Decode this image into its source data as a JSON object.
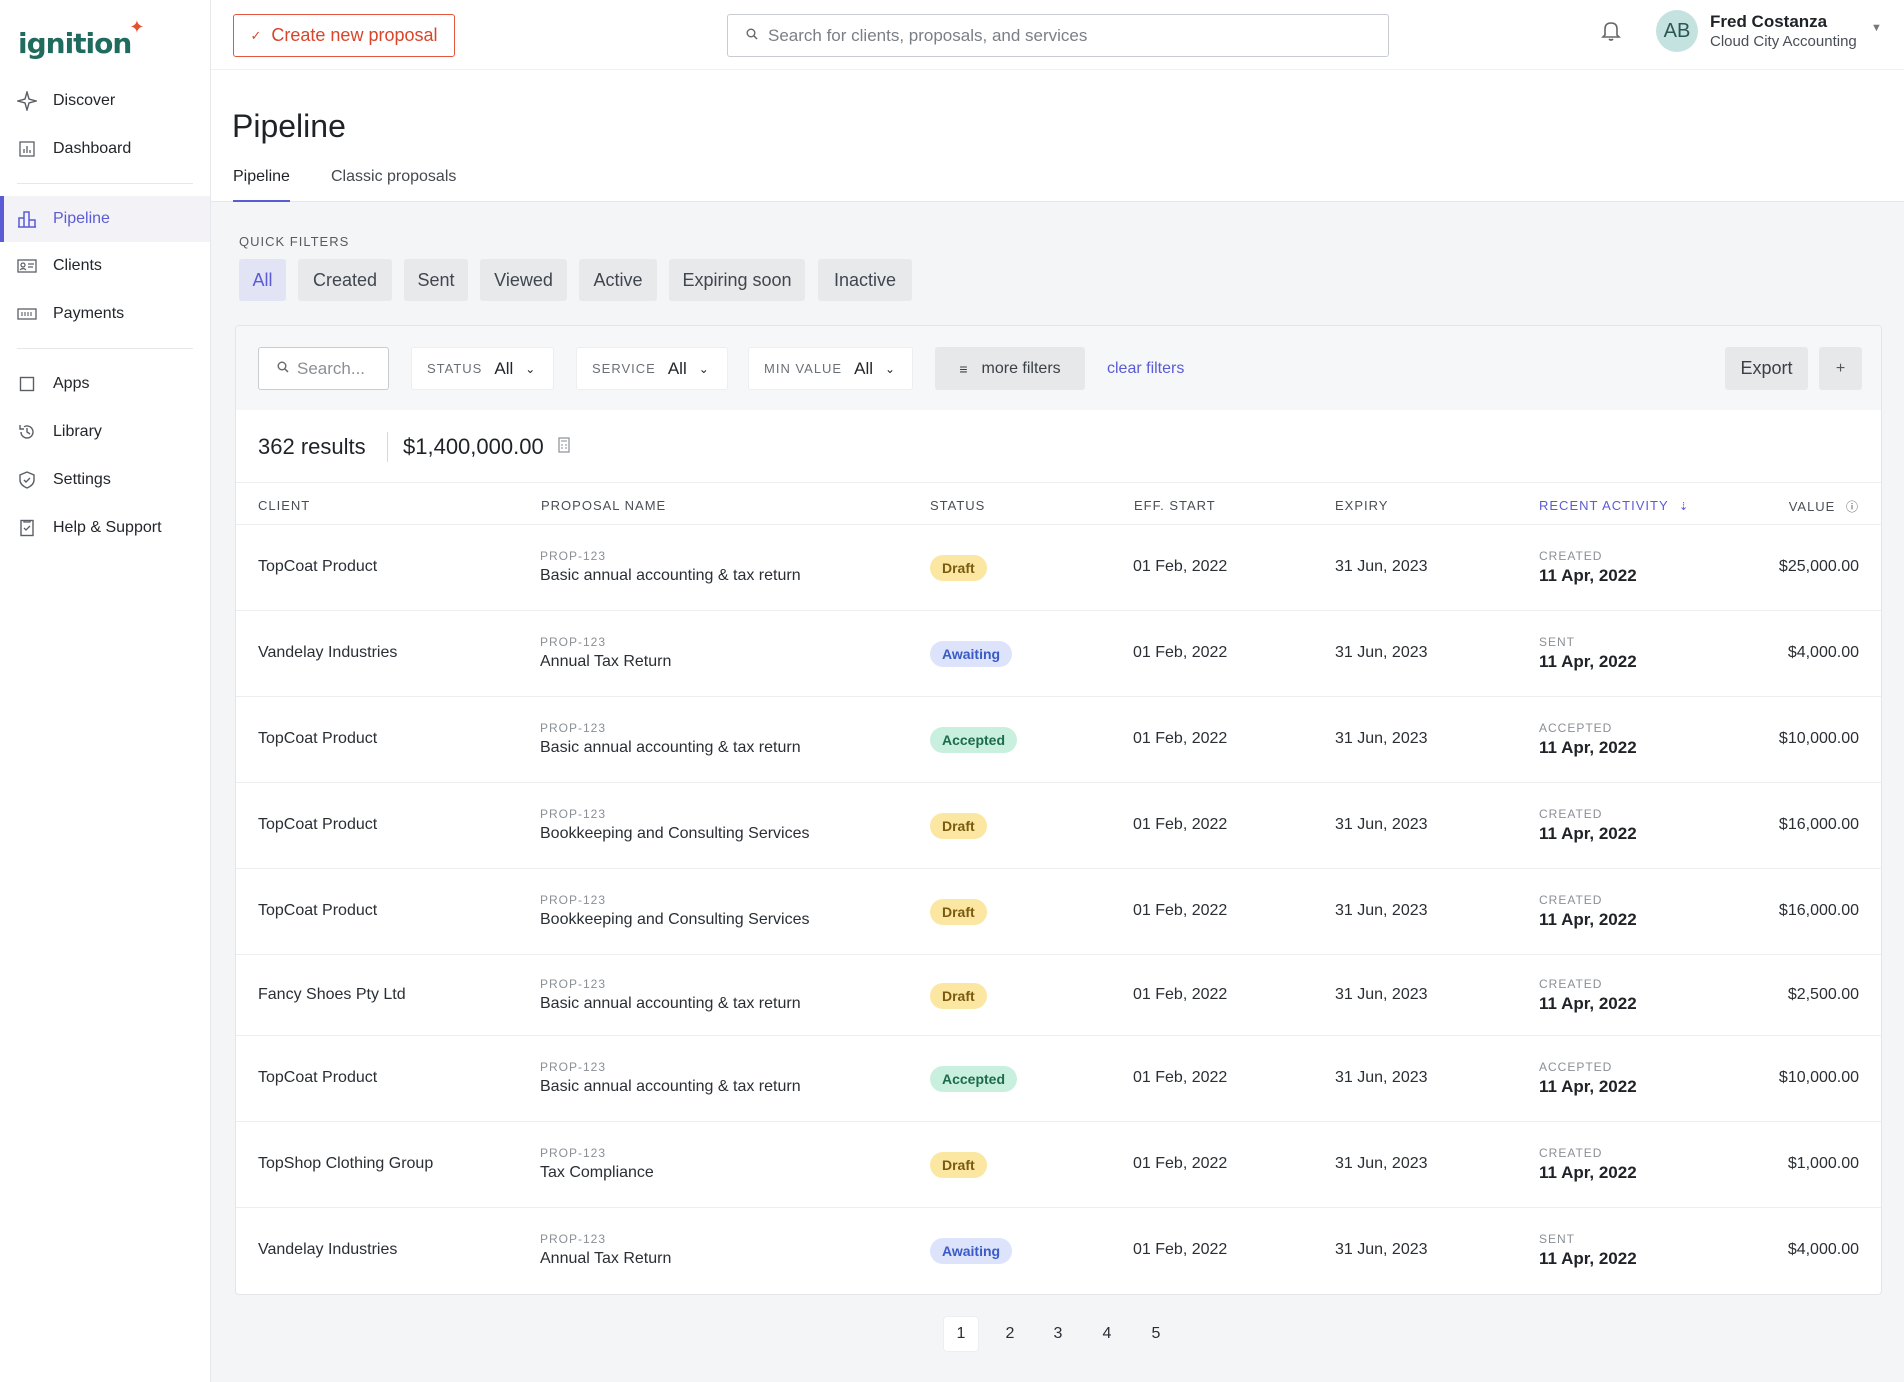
{
  "brand": {
    "name": "ignition",
    "accent": "#5b5bd6",
    "cta_color": "#d9452b"
  },
  "sidebar": {
    "items": [
      {
        "label": "Discover",
        "icon": "sparkle-icon"
      },
      {
        "label": "Dashboard",
        "icon": "dashboard-icon"
      },
      {
        "label": "Pipeline",
        "icon": "bar-chart-icon",
        "active": true
      },
      {
        "label": "Clients",
        "icon": "id-card-icon"
      },
      {
        "label": "Payments",
        "icon": "money-icon"
      },
      {
        "label": "Apps",
        "icon": "square-icon"
      },
      {
        "label": "Library",
        "icon": "library-icon"
      },
      {
        "label": "Settings",
        "icon": "shield-icon"
      },
      {
        "label": "Help & Support",
        "icon": "help-doc-icon"
      }
    ]
  },
  "header": {
    "create_label": "Create new proposal",
    "search_placeholder": "Search for clients, proposals, and services",
    "user": {
      "initials": "AB",
      "name": "Fred Costanza",
      "org": "Cloud City Accounting"
    }
  },
  "page": {
    "title": "Pipeline",
    "tabs": [
      {
        "label": "Pipeline",
        "active": true
      },
      {
        "label": "Classic proposals"
      }
    ]
  },
  "quick_filters": {
    "label": "QUICK FILTERS",
    "chips": [
      "All",
      "Created",
      "Sent",
      "Viewed",
      "Active",
      "Expiring soon",
      "Inactive"
    ],
    "selected": "All"
  },
  "filters": {
    "search_placeholder": "Search...",
    "status": {
      "label": "STATUS",
      "value": "All"
    },
    "service": {
      "label": "SERVICE",
      "value": "All"
    },
    "min_value": {
      "label": "MIN VALUE",
      "value": "All"
    },
    "more_label": "more filters",
    "clear_label": "clear filters",
    "export_label": "Export",
    "add_label": "+"
  },
  "summary": {
    "results": "362 results",
    "total": "$1,400,000.00"
  },
  "table": {
    "columns": [
      "CLIENT",
      "PROPOSAL NAME",
      "STATUS",
      "EFF. START",
      "EXPIRY",
      "RECENT ACTIVITY",
      "VALUE"
    ],
    "rows": [
      {
        "client": "TopCoat Product",
        "prop_id": "PROP-123",
        "proposal": "Basic annual accounting & tax return",
        "status": "Draft",
        "start": "01 Feb, 2022",
        "expiry": "31 Jun, 2023",
        "act_label": "CREATED",
        "act_date": "11 Apr, 2022",
        "value": "$25,000.00"
      },
      {
        "client": "Vandelay Industries",
        "prop_id": "PROP-123",
        "proposal": "Annual Tax Return",
        "status": "Awaiting",
        "start": "01 Feb, 2022",
        "expiry": "31 Jun, 2023",
        "act_label": "SENT",
        "act_date": "11 Apr, 2022",
        "value": "$4,000.00"
      },
      {
        "client": "TopCoat Product",
        "prop_id": "PROP-123",
        "proposal": "Basic annual accounting & tax return",
        "status": "Accepted",
        "start": "01 Feb, 2022",
        "expiry": "31 Jun, 2023",
        "act_label": "ACCEPTED",
        "act_date": "11 Apr, 2022",
        "value": "$10,000.00"
      },
      {
        "client": "TopCoat Product",
        "prop_id": "PROP-123",
        "proposal": "Bookkeeping and Consulting Services",
        "status": "Draft",
        "start": "01 Feb, 2022",
        "expiry": "31 Jun, 2023",
        "act_label": "CREATED",
        "act_date": "11 Apr, 2022",
        "value": "$16,000.00"
      },
      {
        "client": "TopCoat Product",
        "prop_id": "PROP-123",
        "proposal": "Bookkeeping and Consulting Services",
        "status": "Draft",
        "start": "01 Feb, 2022",
        "expiry": "31 Jun, 2023",
        "act_label": "CREATED",
        "act_date": "11 Apr, 2022",
        "value": "$16,000.00"
      },
      {
        "client": "Fancy Shoes Pty Ltd",
        "prop_id": "PROP-123",
        "proposal": "Basic annual accounting & tax return",
        "status": "Draft",
        "start": "01 Feb, 2022",
        "expiry": "31 Jun, 2023",
        "act_label": "CREATED",
        "act_date": "11 Apr, 2022",
        "value": "$2,500.00"
      },
      {
        "client": "TopCoat Product",
        "prop_id": "PROP-123",
        "proposal": "Basic annual accounting & tax return",
        "status": "Accepted",
        "start": "01 Feb, 2022",
        "expiry": "31 Jun, 2023",
        "act_label": "ACCEPTED",
        "act_date": "11 Apr, 2022",
        "value": "$10,000.00"
      },
      {
        "client": "TopShop Clothing Group",
        "prop_id": "PROP-123",
        "proposal": "Tax Compliance",
        "status": "Draft",
        "start": "01 Feb, 2022",
        "expiry": "31 Jun, 2023",
        "act_label": "CREATED",
        "act_date": "11 Apr, 2022",
        "value": "$1,000.00"
      },
      {
        "client": "Vandelay Industries",
        "prop_id": "PROP-123",
        "proposal": "Annual Tax Return",
        "status": "Awaiting",
        "start": "01 Feb, 2022",
        "expiry": "31 Jun, 2023",
        "act_label": "SENT",
        "act_date": "11 Apr, 2022",
        "value": "$4,000.00"
      }
    ]
  },
  "pagination": {
    "pages": [
      "1",
      "2",
      "3",
      "4",
      "5"
    ],
    "current": "1"
  }
}
